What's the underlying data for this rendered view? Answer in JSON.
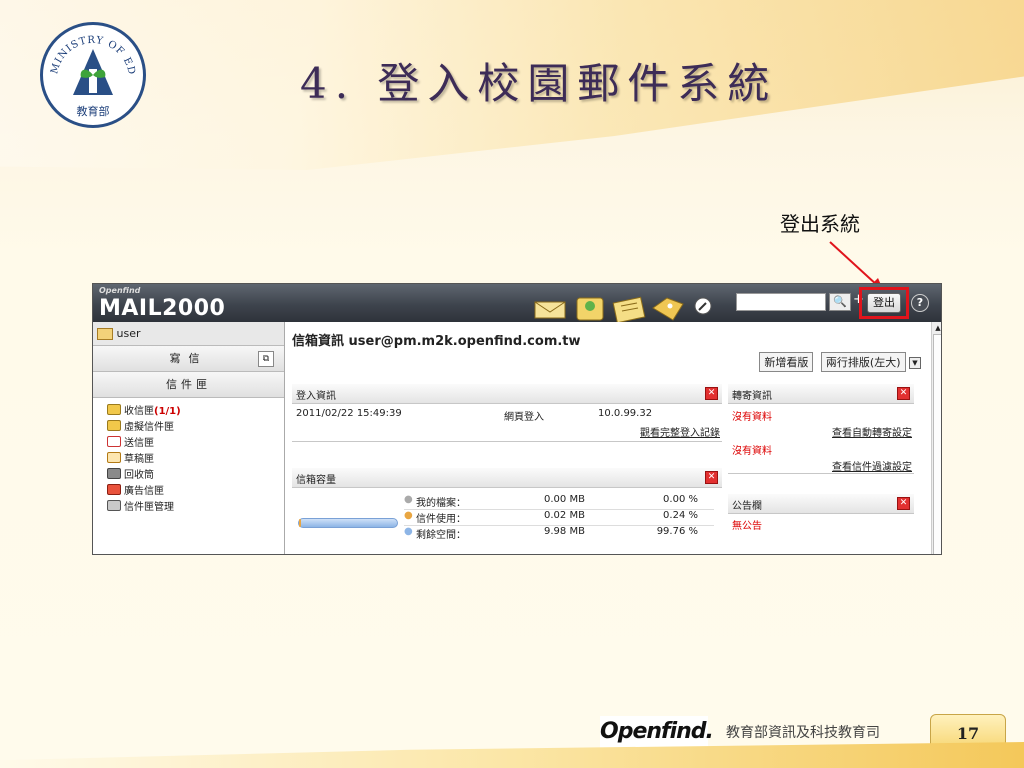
{
  "slide": {
    "seal_text": "MINISTRY OF EDUCATION",
    "seal_center": "教育部",
    "title": "4. 登入校園郵件系統",
    "callout": "登出系統",
    "footer_logo": "Openfind.",
    "footer_text": "教育部資訊及科技教育司",
    "page_number": "17"
  },
  "app": {
    "brand_small": "Openfind",
    "brand": "MAIL2000",
    "search_button": "🔍",
    "plus": "+",
    "logout_label": "登出",
    "help_label": "?",
    "colors": {
      "highlight": "#e0141c",
      "count_red": "#cc0000"
    }
  },
  "sidebar": {
    "user": "user",
    "compose": "寫信",
    "folders_header": "信件匣",
    "folders": [
      {
        "label": "收信匣",
        "count": "(1/1)",
        "icon": "inbox-icon"
      },
      {
        "label": "虛擬信件匣",
        "count": "",
        "icon": "virtual-folder-icon"
      },
      {
        "label": "送信匣",
        "count": "",
        "icon": "sent-icon"
      },
      {
        "label": "草稿匣",
        "count": "",
        "icon": "draft-icon"
      },
      {
        "label": "回收筒",
        "count": "",
        "icon": "trash-icon"
      },
      {
        "label": "廣告信匣",
        "count": "",
        "icon": "spam-icon"
      },
      {
        "label": "信件匣管理",
        "count": "",
        "icon": "tools-icon"
      }
    ]
  },
  "main": {
    "header_label": "信箱資訊",
    "header_email": "user@pm.m2k.openfind.com.tw",
    "new_board": "新增看版",
    "layout_select": "兩行排版(左大)",
    "login_panel": {
      "title": "登入資訊",
      "time": "2011/02/22 15:49:39",
      "type": "網頁登入",
      "ip": "10.0.99.32",
      "full_log": "觀看完整登入記錄"
    },
    "storage_panel": {
      "title": "信箱容量",
      "usage_fraction": 0.0024,
      "rows": [
        {
          "label": "我的檔案：",
          "size": "0.00 MB",
          "pct": "0.00 %"
        },
        {
          "label": "信件使用：",
          "size": "0.02 MB",
          "pct": "0.24 %"
        },
        {
          "label": "剩餘空間：",
          "size": "9.98 MB",
          "pct": "99.76 %"
        }
      ]
    },
    "forward_panel": {
      "title": "轉寄資訊",
      "no_data_1": "沒有資料",
      "link_1": "查看自動轉寄設定",
      "no_data_2": "沒有資料",
      "link_2": "查看信件過濾設定"
    },
    "bulletin_panel": {
      "title": "公告欄",
      "empty": "無公告"
    }
  }
}
